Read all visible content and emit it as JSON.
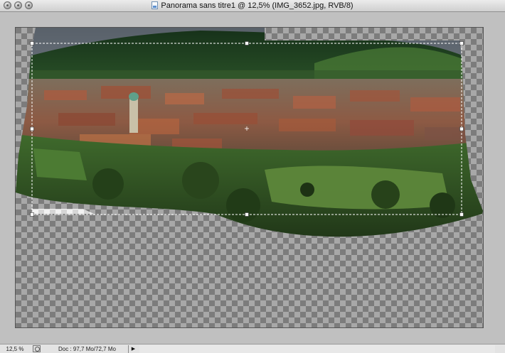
{
  "window": {
    "title": "Panorama sans titre1 @ 12,5% (IMG_3652.jpg, RVB/8)"
  },
  "status": {
    "zoom": "12,5 %",
    "doc_info": "Doc : 97,7 Mo/72,7 Mo",
    "menu_arrow": "▶"
  },
  "icons": {
    "close": "close-icon",
    "minimize": "minimize-icon",
    "zoom": "zoom-icon",
    "document": "document-icon",
    "status_menu": "status-menu-icon"
  },
  "colors": {
    "checker_light": "#a8a8a8",
    "checker_dark": "#7c7c7c",
    "crop_border": "#ffffff"
  }
}
